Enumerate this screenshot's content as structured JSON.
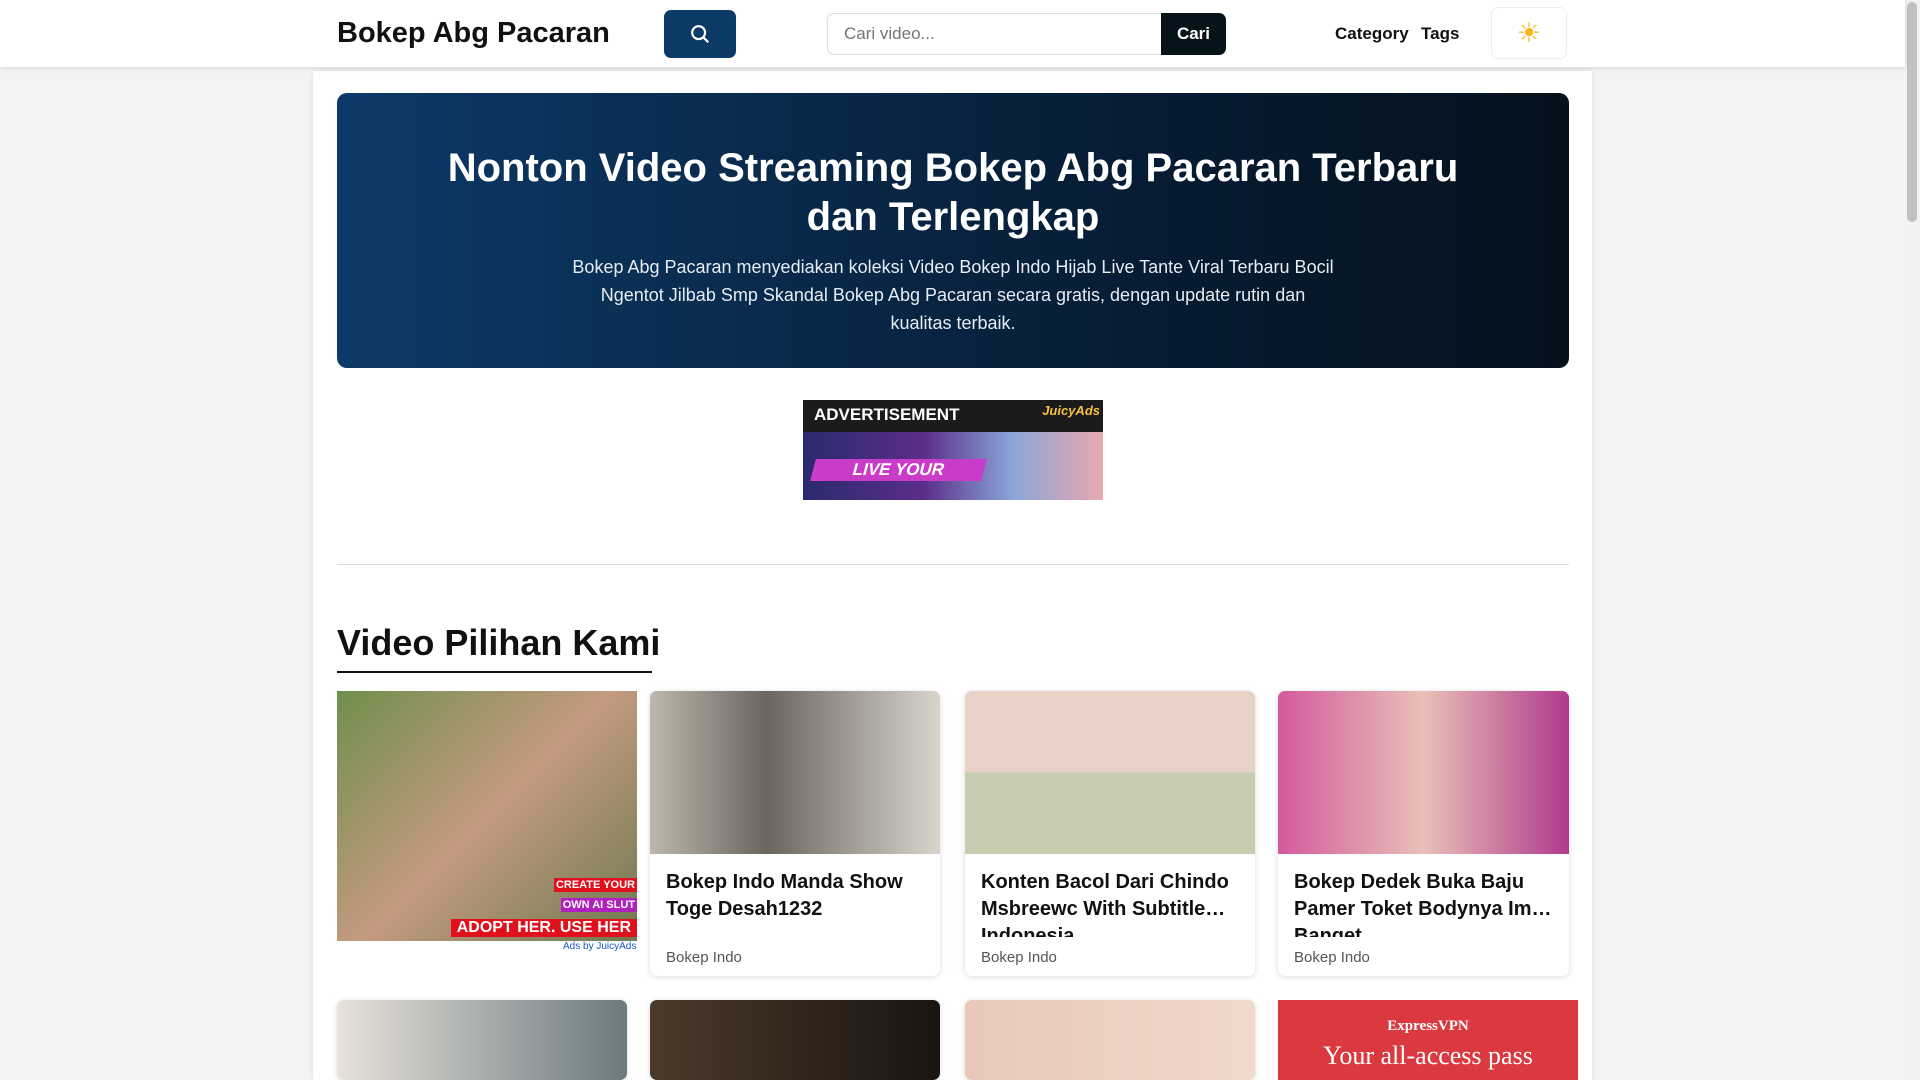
{
  "header": {
    "logo": "Bokep Abg Pacaran",
    "search_placeholder": "Cari video...",
    "search_button": "Cari",
    "nav": [
      "Category",
      "Tags"
    ],
    "theme_icon": "sun-icon"
  },
  "hero": {
    "title": "Nonton Video Streaming Bokep Abg Pacaran Terbaru dan Terlengkap",
    "description": "Bokep Abg Pacaran menyediakan koleksi Video Bokep Indo Hijab Live Tante Viral Terbaru Bocil Ngentot Jilbab Smp Skandal Bokep Abg Pacaran secara gratis, dengan update rutin dan kualitas terbaik."
  },
  "ad_banner": {
    "label": "ADVERTISEMENT",
    "brand": "JuicyAds",
    "cta": "LIVE YOUR"
  },
  "section": {
    "title": "Video Pilihan Kami"
  },
  "side_ad": {
    "line1": "CREATE YOUR",
    "line2": "OWN AI SLUT",
    "line3": "ADOPT HER. USE HER",
    "credit": "Ads by JuicyAds"
  },
  "videos": [
    {
      "title": "Bokep Indo Manda Show Toge Desah1232",
      "category": "Bokep Indo"
    },
    {
      "title": "Konten Bacol Dari Chindo Msbreewc With Subtitle Indonesia",
      "category": "Bokep Indo"
    },
    {
      "title": "Bokep Dedek Buka Baju Pamer Toket Bodynya Imut Banget",
      "category": "Bokep Indo"
    }
  ],
  "vpn_ad": {
    "brand": "ExpressVPN",
    "headline": "Your all-access pass"
  }
}
